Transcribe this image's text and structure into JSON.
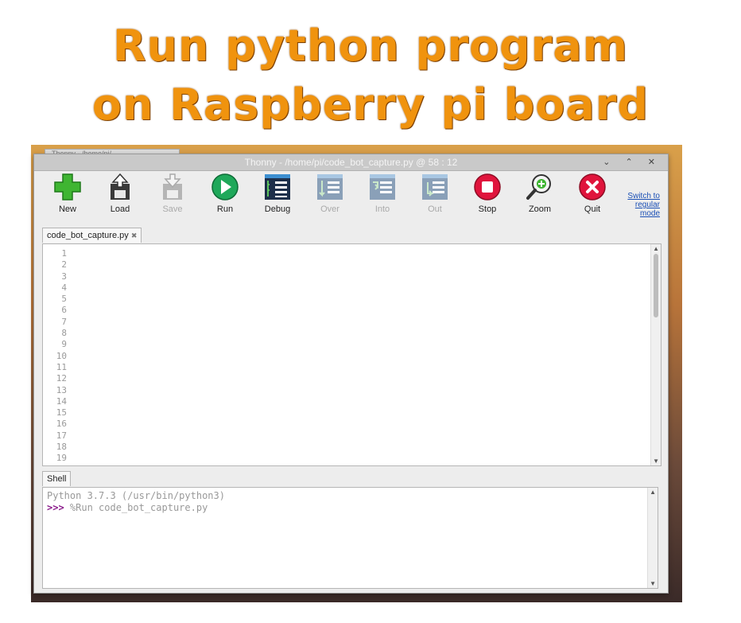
{
  "headline": {
    "line1": "Run python program",
    "line2": "on Raspberry pi board"
  },
  "background_window": {
    "title": "Thonny  -  /home/pi/..."
  },
  "window": {
    "title": "Thonny  -  /home/pi/code_bot_capture.py  @  58 : 12",
    "controls": "⌄ ⌃ ✕"
  },
  "toolbar": {
    "buttons": [
      {
        "label": "New",
        "icon": "plus-icon",
        "enabled": true
      },
      {
        "label": "Load",
        "icon": "load-icon",
        "enabled": true
      },
      {
        "label": "Save",
        "icon": "save-icon",
        "enabled": false
      },
      {
        "label": "Run",
        "icon": "run-icon",
        "enabled": true
      },
      {
        "label": "Debug",
        "icon": "debug-icon",
        "enabled": true
      },
      {
        "label": "Over",
        "icon": "step-over-icon",
        "enabled": false
      },
      {
        "label": "Into",
        "icon": "step-into-icon",
        "enabled": false
      },
      {
        "label": "Out",
        "icon": "step-out-icon",
        "enabled": false
      },
      {
        "label": "Stop",
        "icon": "stop-icon",
        "enabled": true
      },
      {
        "label": "Zoom",
        "icon": "zoom-icon",
        "enabled": true
      },
      {
        "label": "Quit",
        "icon": "quit-icon",
        "enabled": true
      }
    ],
    "switch_mode": "Switch to regular mode"
  },
  "editor": {
    "tab_label": "code_bot_capture.py",
    "tab_close": "✖",
    "line_numbers": [
      "1",
      "2",
      "3",
      "4",
      "5",
      "6",
      "7",
      "8",
      "9",
      "10",
      "11",
      "12",
      "13",
      "14",
      "15",
      "16",
      "17",
      "18",
      "19"
    ]
  },
  "shell": {
    "tab_label": "Shell",
    "line1": "Python 3.7.3 (/usr/bin/python3)",
    "prompt": ">>>",
    "command": " %Run code_bot_capture.py"
  },
  "colors": {
    "headline": "#f0930e",
    "keyword": "#7a1d6b",
    "string": "#2c7a1d",
    "number": "#b35500"
  }
}
